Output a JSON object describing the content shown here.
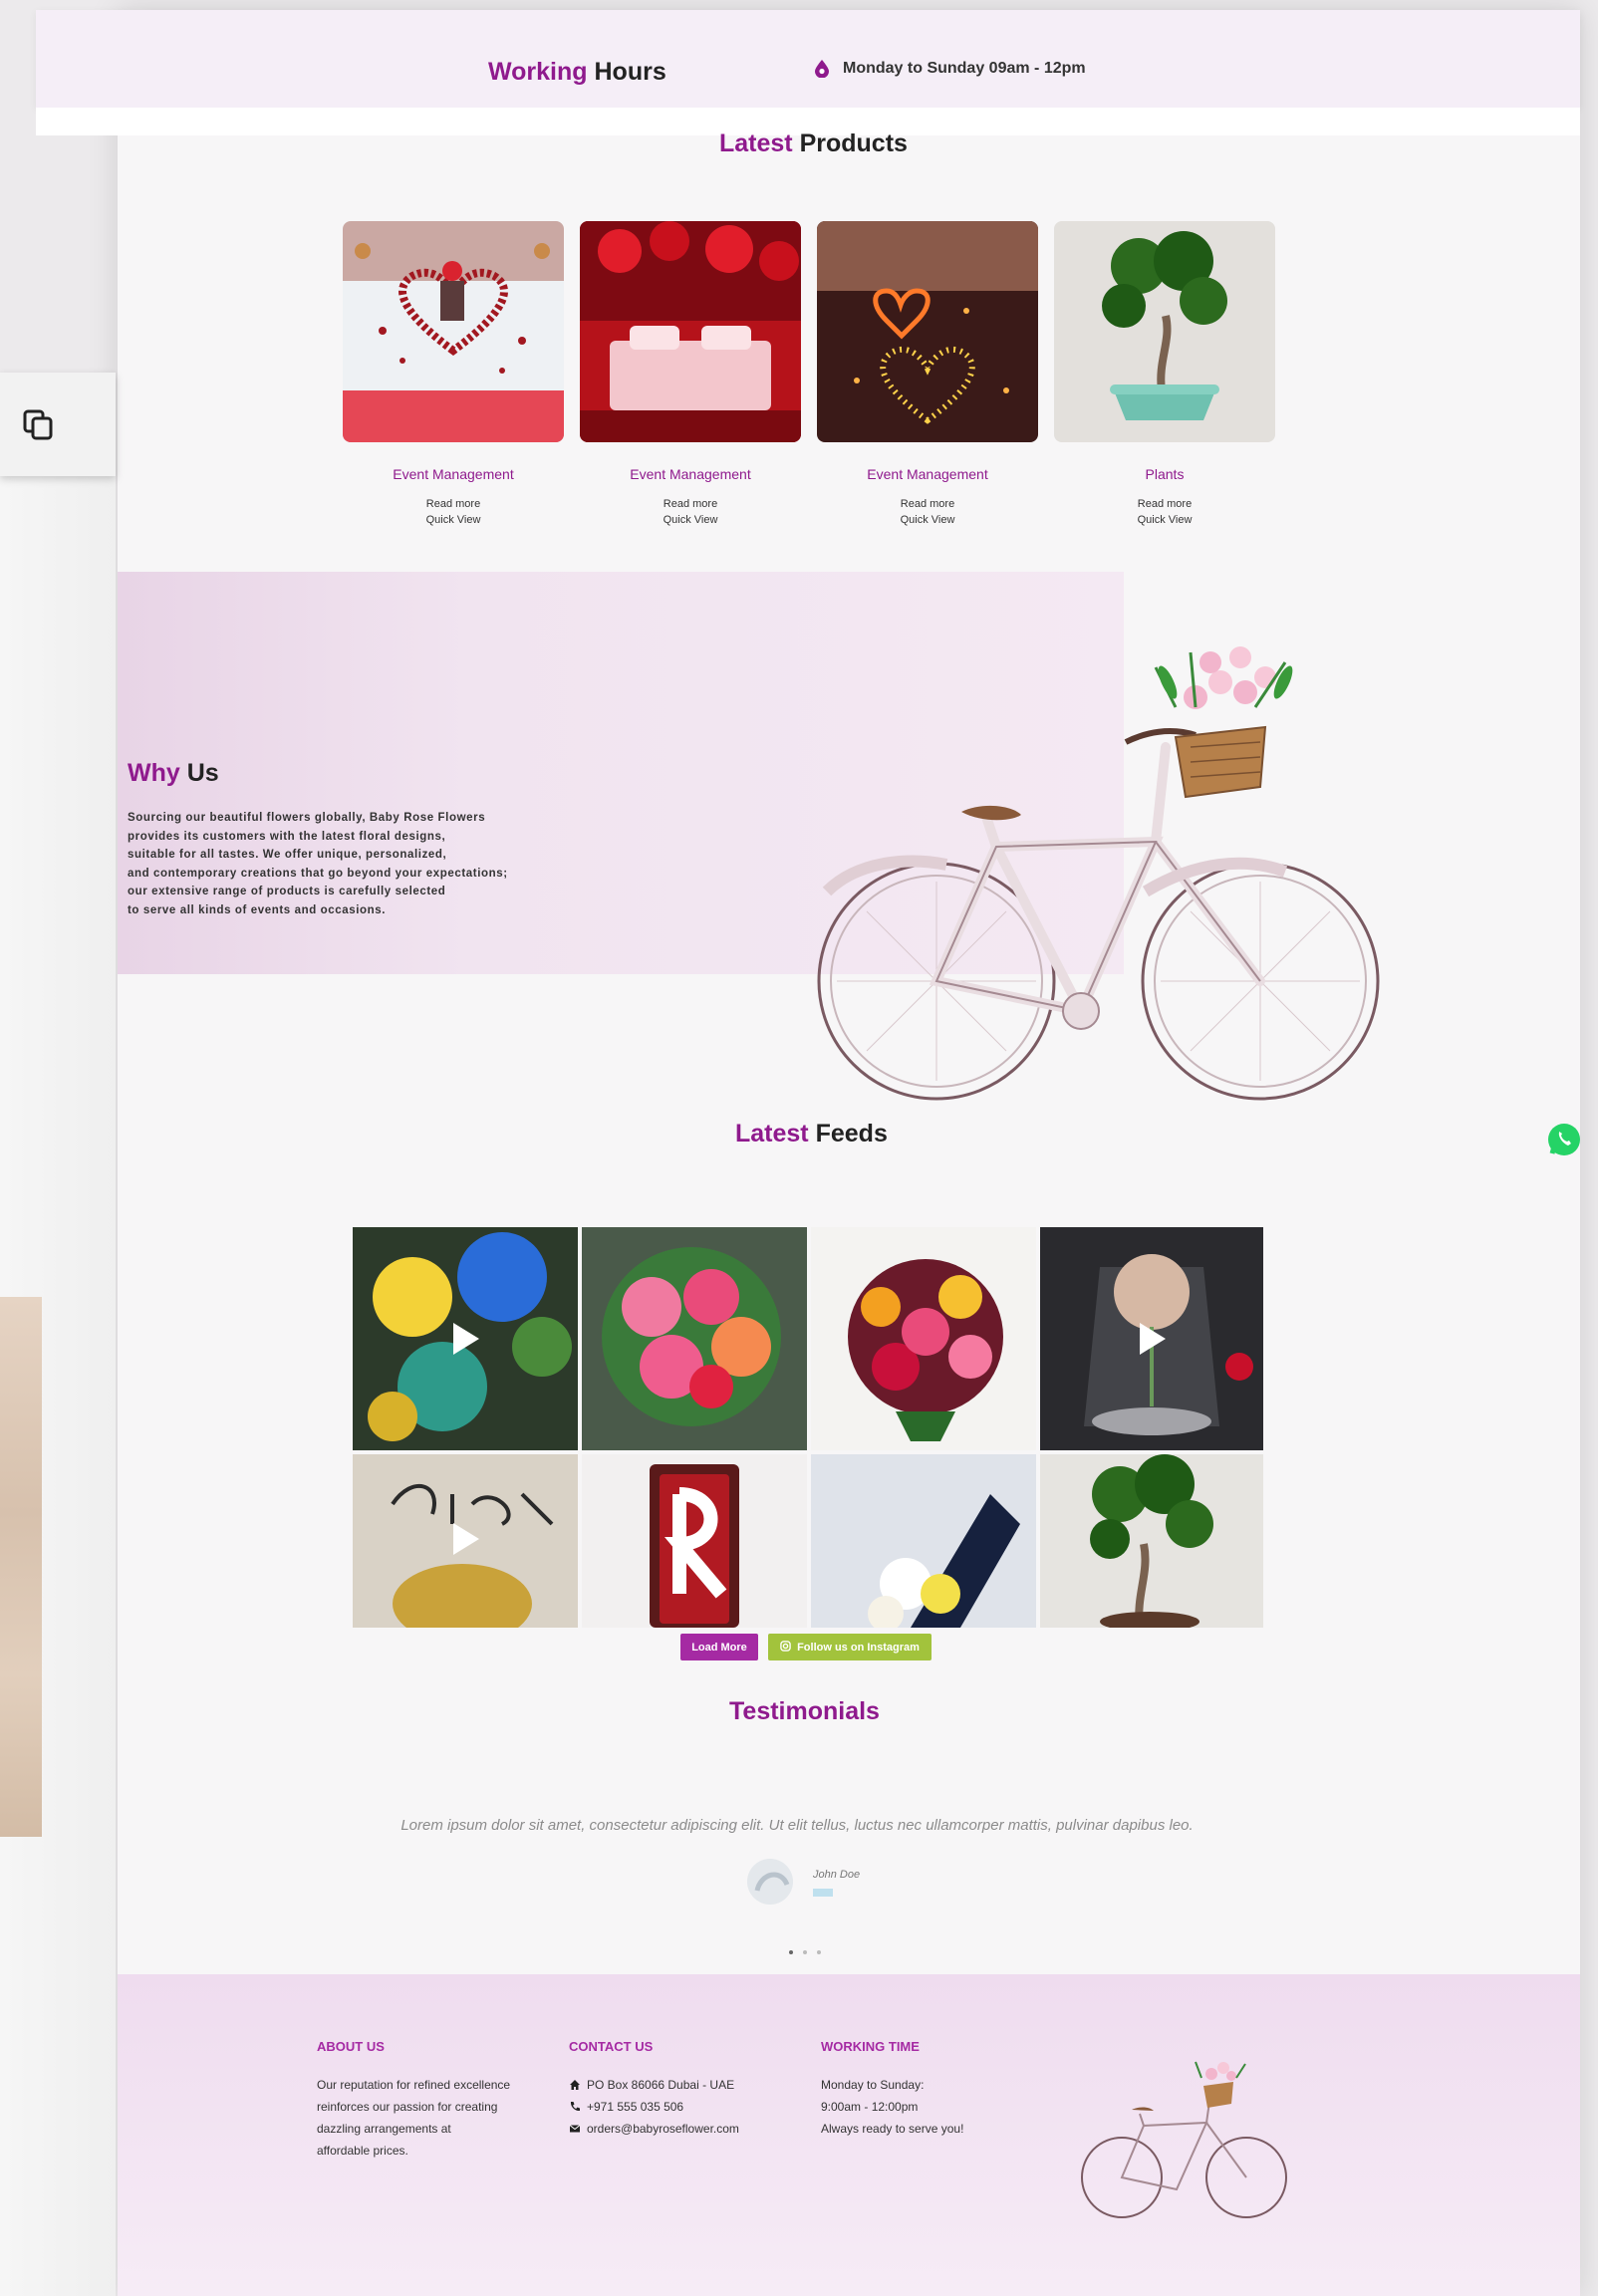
{
  "header": {
    "working_word": "Working",
    "hours_word": "Hours",
    "schedule": "Monday to Sunday 09am - 12pm",
    "drop_icon": "water-drop-icon"
  },
  "products": {
    "title_accent": "Latest",
    "title_rest": "Products",
    "items": [
      {
        "category": "Event Management",
        "read_more": "Read more",
        "quick_view": "Quick View"
      },
      {
        "category": "Event Management",
        "read_more": "Read more",
        "quick_view": "Quick View"
      },
      {
        "category": "Event Management",
        "read_more": "Read more",
        "quick_view": "Quick View"
      },
      {
        "category": "Plants",
        "read_more": "Read more",
        "quick_view": "Quick View"
      }
    ]
  },
  "why": {
    "title_accent": "Why",
    "title_rest": "Us",
    "lines": [
      "Sourcing our beautiful flowers globally, Baby Rose Flowers",
      "provides its customers with the latest floral designs,",
      "suitable for all tastes. We offer unique, personalized,",
      "and contemporary creations that go beyond your expectations;",
      "our extensive range of products is carefully selected",
      "to serve all kinds of events and occasions."
    ]
  },
  "feeds": {
    "title_accent": "Latest",
    "title_rest": "Feeds",
    "load_more": "Load More",
    "instagram": "Follow us on Instagram",
    "instagram_icon": "instagram-icon",
    "play_icon": "play-icon"
  },
  "testimonials": {
    "title": "Testimonials",
    "quote": "Lorem ipsum dolor sit amet, consectetur adipiscing elit. Ut elit tellus, luctus nec ullamcorper mattis, pulvinar dapibus leo.",
    "name": "John Doe"
  },
  "footer": {
    "about": {
      "heading": "ABOUT US",
      "lines": [
        "Our reputation for refined excellence",
        "reinforces our passion for creating",
        "dazzling arrangements at",
        "affordable prices."
      ]
    },
    "contact": {
      "heading": "CONTACT US",
      "address": "PO Box 86066 Dubai - UAE",
      "phone": "+971 555 035 506",
      "email": "orders@babyroseflower.com"
    },
    "working": {
      "heading": "WORKING TIME",
      "lines": [
        "Monday to Sunday:",
        "9:00am - 12:00pm",
        "Always ready to serve you!"
      ]
    }
  },
  "colors": {
    "accent": "#8f1a8d",
    "button_purple": "#a52aa3",
    "button_green": "#a2c33c"
  }
}
